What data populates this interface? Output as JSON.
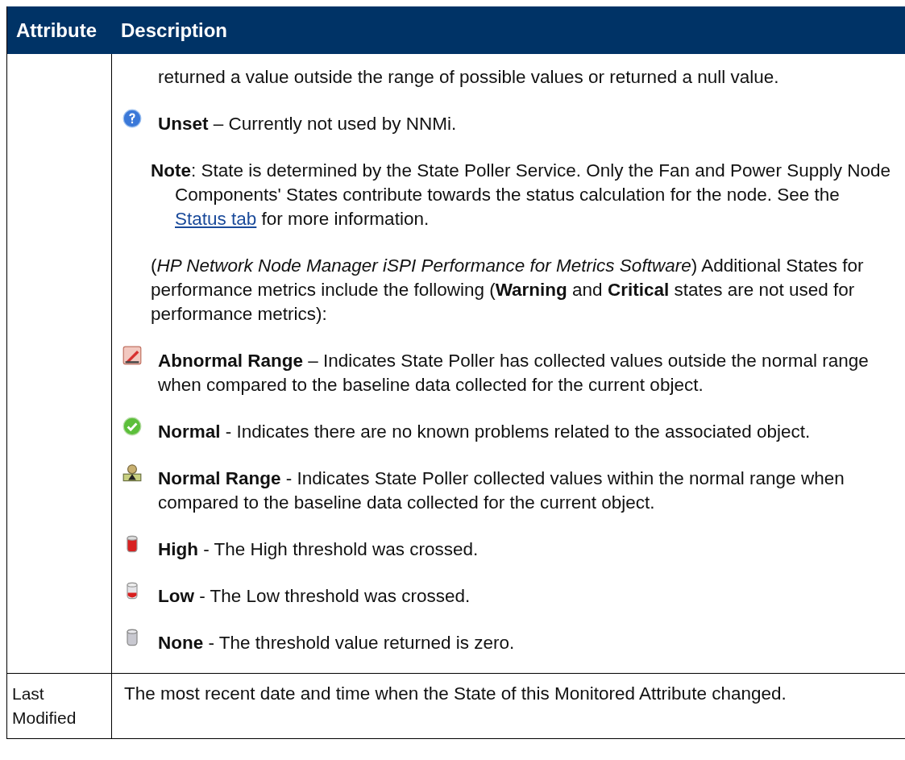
{
  "table": {
    "columns": [
      "Attribute",
      "Description"
    ],
    "rows": [
      {
        "description": [
          {
            "kind": "continuation",
            "text": "returned a value outside the range of possible values or returned a null value."
          },
          {
            "kind": "unset",
            "text": "**Unset** – Currently not used by NNMi."
          },
          {
            "kind": "note",
            "text": "**Note**: State is determined by the State Poller Service. Only the Fan and Power Supply Node Components' States contribute towards the status calculation for the node. See the ",
            "link": "Status tab",
            "after": " for more information."
          },
          {
            "kind": "paragraph",
            "text": "(*HP Network Node Manager iSPI Performance for Metrics Software*) Additional States for performance metrics include the following (**Warning** and **Critical** states are not used for performance metrics):"
          },
          {
            "kind": "abnormal",
            "text": "**Abnormal Range** – Indicates State Poller has collected values outside the normal range when compared to the baseline data collected for the current object."
          },
          {
            "kind": "normal",
            "text": "**Normal** - Indicates there are no known problems related to the associated object."
          },
          {
            "kind": "range",
            "text": "**Normal Range** - Indicates State Poller collected values within the normal range when compared to the baseline data collected for the current object."
          },
          {
            "kind": "high",
            "text": "**High** - The High threshold was crossed."
          },
          {
            "kind": "low",
            "text": "**Low** - The Low threshold was crossed."
          },
          {
            "kind": "none",
            "text": "**None** - The threshold value returned is zero."
          }
        ]
      },
      {
        "attribute": "Last Modified",
        "description": [
          {
            "kind": "plain",
            "text": "The most recent date and time when the State of this Monitored Attribute changed."
          }
        ]
      }
    ]
  }
}
